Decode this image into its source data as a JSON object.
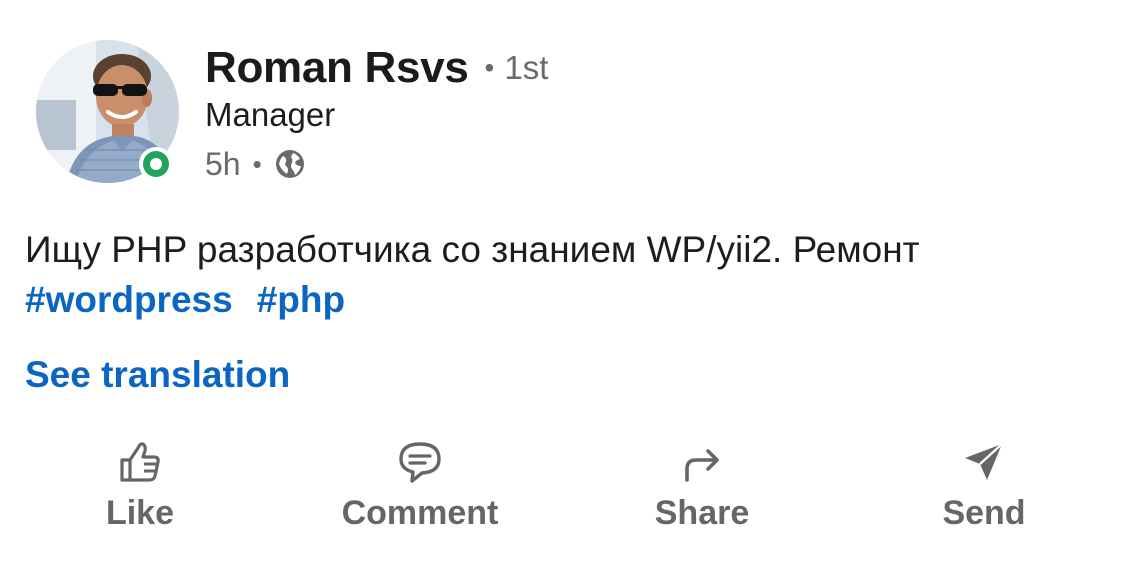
{
  "author": {
    "name": "Roman Rsvs",
    "connection_degree": "1st",
    "headline": "Manager",
    "online": true
  },
  "meta": {
    "time_ago": "5h",
    "visibility_icon": "globe-icon"
  },
  "post": {
    "text": "Ищу PHP разработчика со знанием WP/yii2. Ремонт",
    "hashtags": [
      "#wordpress",
      "#php"
    ],
    "see_translation": "See translation"
  },
  "actions": [
    {
      "label": "Like",
      "icon": "thumbs-up-icon"
    },
    {
      "label": "Comment",
      "icon": "comment-icon"
    },
    {
      "label": "Share",
      "icon": "share-arrow-icon"
    },
    {
      "label": "Send",
      "icon": "send-icon"
    }
  ],
  "colors": {
    "link": "#0a66c2",
    "presence": "#1fa45a",
    "muted": "#666666",
    "text": "#1d1d1d"
  }
}
